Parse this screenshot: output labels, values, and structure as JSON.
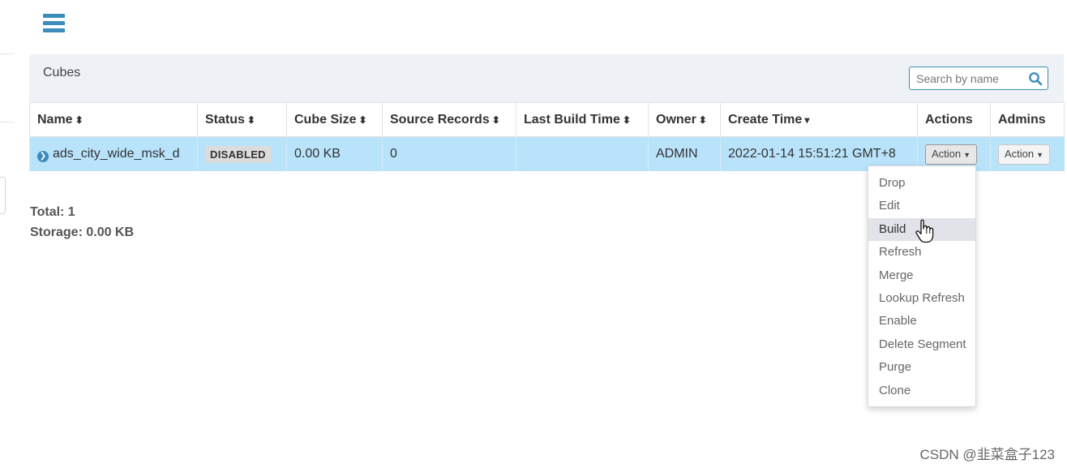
{
  "panel": {
    "title": "Cubes",
    "search_placeholder": "Search by name"
  },
  "table": {
    "headers": [
      {
        "label": "Name",
        "sort_icon": "sort-icon"
      },
      {
        "label": "Status",
        "sort_icon": "sort-icon"
      },
      {
        "label": "Cube Size",
        "sort_icon": "sort-icon"
      },
      {
        "label": "Source Records",
        "sort_icon": "sort-icon"
      },
      {
        "label": "Last Build Time",
        "sort_icon": "sort-icon"
      },
      {
        "label": "Owner",
        "sort_icon": "sort-icon"
      },
      {
        "label": "Create Time",
        "sort_icon": "sort-desc-icon"
      },
      {
        "label": "Actions"
      },
      {
        "label": "Admins"
      }
    ],
    "rows": [
      {
        "name": "ads_city_wide_msk_d",
        "status": "DISABLED",
        "cube_size": "0.00 KB",
        "source_records": "0",
        "last_build_time": "",
        "owner": "ADMIN",
        "create_time": "2022-01-14 15:51:21 GMT+8",
        "actions_label": "Action",
        "admins_label": "Action"
      }
    ]
  },
  "summary": {
    "total": "Total: 1",
    "storage": "Storage: 0.00 KB"
  },
  "action_menu": {
    "items": [
      "Drop",
      "Edit",
      "Build",
      "Refresh",
      "Merge",
      "Lookup Refresh",
      "Enable",
      "Delete Segment",
      "Purge",
      "Clone"
    ],
    "hovered": "Build"
  },
  "watermark": "CSDN @韭菜盒子123",
  "colors": {
    "accent": "#3c8dbc",
    "row_highlight": "#b9e3fb",
    "header_bg": "#eef1f6"
  },
  "icons": {
    "menu": "hamburger-menu-icon",
    "search": "search-icon",
    "expand": "chevron-right-circle-icon",
    "cursor": "hand-pointer-icon"
  }
}
